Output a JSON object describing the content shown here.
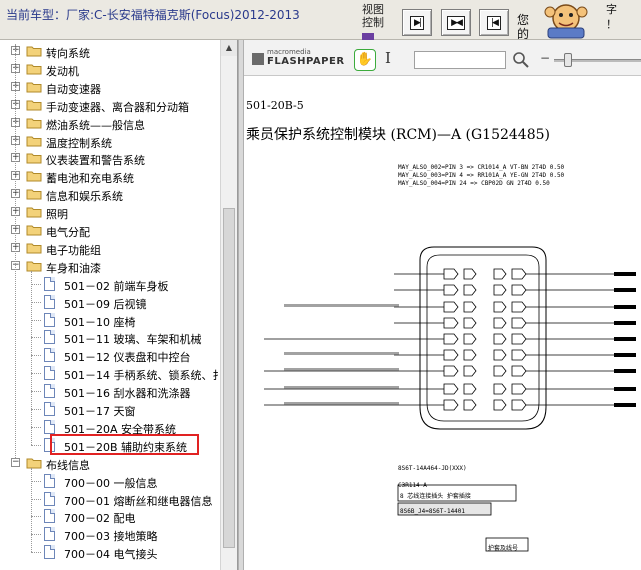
{
  "topbar": {
    "car_label": "当前车型：厂家:C-长安福特福克斯(Focus)2012-2013",
    "view_control": "视图控制",
    "nav_first": "▶|",
    "nav_prev": "▶◀",
    "nav_next": "|◀",
    "cutoff_text": "您的",
    "mascot_text_1": "字",
    "mascot_text_2": "！"
  },
  "tree": {
    "items": [
      {
        "label": "转向系统",
        "level": 0,
        "type": "folder",
        "state": "collapsed"
      },
      {
        "label": "发动机",
        "level": 0,
        "type": "folder",
        "state": "collapsed"
      },
      {
        "label": "自动变速器",
        "level": 0,
        "type": "folder",
        "state": "collapsed"
      },
      {
        "label": "手动变速器、离合器和分动箱",
        "level": 0,
        "type": "folder",
        "state": "collapsed"
      },
      {
        "label": "燃油系统——般信息",
        "level": 0,
        "type": "folder",
        "state": "collapsed"
      },
      {
        "label": "温度控制系统",
        "level": 0,
        "type": "folder",
        "state": "collapsed"
      },
      {
        "label": "仪表装置和警告系统",
        "level": 0,
        "type": "folder",
        "state": "collapsed"
      },
      {
        "label": "蓄电池和充电系统",
        "level": 0,
        "type": "folder",
        "state": "collapsed"
      },
      {
        "label": "信息和娱乐系统",
        "level": 0,
        "type": "folder",
        "state": "collapsed"
      },
      {
        "label": "照明",
        "level": 0,
        "type": "folder",
        "state": "collapsed"
      },
      {
        "label": "电气分配",
        "level": 0,
        "type": "folder",
        "state": "collapsed"
      },
      {
        "label": "电子功能组",
        "level": 0,
        "type": "folder",
        "state": "collapsed"
      },
      {
        "label": "车身和油漆",
        "level": 0,
        "type": "folder",
        "state": "expanded"
      },
      {
        "label": "501－02 前端车身板",
        "level": 1,
        "type": "doc"
      },
      {
        "label": "501－09 后视镜",
        "level": 1,
        "type": "doc"
      },
      {
        "label": "501－10 座椅",
        "level": 1,
        "type": "doc"
      },
      {
        "label": "501－11 玻璃、车架和机械",
        "level": 1,
        "type": "doc"
      },
      {
        "label": "501－12 仪表盘和中控台",
        "level": 1,
        "type": "doc"
      },
      {
        "label": "501－14 手柄系统、锁系统、扌",
        "level": 1,
        "type": "doc"
      },
      {
        "label": "501－16 刮水器和洗涤器",
        "level": 1,
        "type": "doc"
      },
      {
        "label": "501－17 天窗",
        "level": 1,
        "type": "doc"
      },
      {
        "label": "501－20A 安全带系统",
        "level": 1,
        "type": "doc"
      },
      {
        "label": "501－20B 辅助约束系统",
        "level": 1,
        "type": "doc",
        "selected": true
      },
      {
        "label": "布线信息",
        "level": 0,
        "type": "folder",
        "state": "expanded"
      },
      {
        "label": "700－00 一般信息",
        "level": 1,
        "type": "doc"
      },
      {
        "label": "700－01 熔断丝和继电器信息",
        "level": 1,
        "type": "doc"
      },
      {
        "label": "700－02 配电",
        "level": 1,
        "type": "doc"
      },
      {
        "label": "700－03 接地策略",
        "level": 1,
        "type": "doc"
      },
      {
        "label": "700－04 电气接头",
        "level": 1,
        "type": "doc"
      }
    ]
  },
  "viewer": {
    "logo_small": "macromedia",
    "logo_big": "FLASHPAPER",
    "search_value": "",
    "page_number": "501-20B-5",
    "page_title": "乘员保护系统控制模块 (RCM)—A (G1524485)",
    "wire_headers": [
      "MAY_ALSO_002=PIN 3 => CR1014_A VT-BN 2T4D 0.50",
      "MAY_ALSO_003=PIN 4 => RR101A_A YE-GN 2T4D 0.50",
      "MAY_ALSO_004=PIN 24 => CBP02D GN 2T4D 0.50"
    ],
    "connector_label": "8S6T-14A464-JD(XXX)",
    "ref_label": "C3R114-A",
    "box_line_1": "8 芯线连接插头 护套插接",
    "box_line_2": "8S6B_J4=8S6T-14401",
    "small_box_label": "护套及线号"
  }
}
